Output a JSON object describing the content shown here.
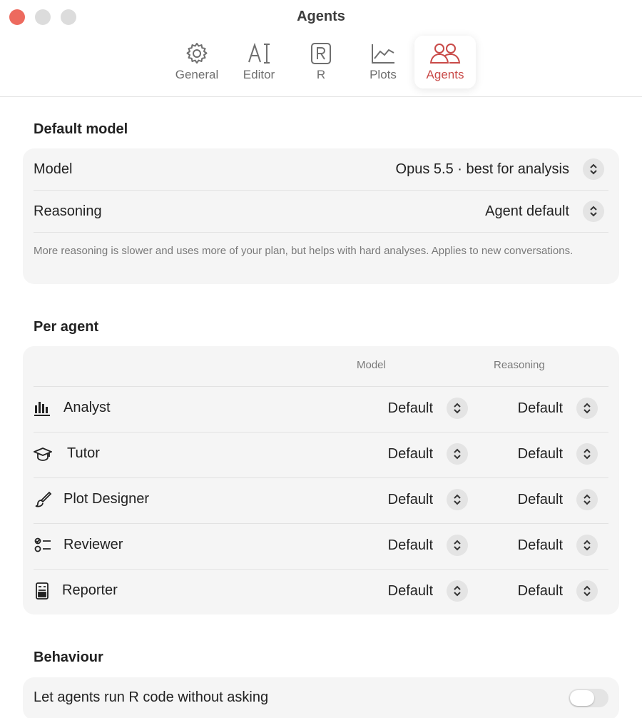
{
  "window": {
    "title": "Agents"
  },
  "tabs": [
    {
      "label": "General",
      "icon": "gear-icon"
    },
    {
      "label": "Editor",
      "icon": "text-cursor-icon"
    },
    {
      "label": "R",
      "icon": "r-box-icon"
    },
    {
      "label": "Plots",
      "icon": "line-chart-icon"
    },
    {
      "label": "Agents",
      "icon": "people-icon",
      "active": true
    }
  ],
  "default_model": {
    "title": "Default model",
    "model_label": "Model",
    "model_value": "Opus 5.5 · best for analysis",
    "reasoning_label": "Reasoning",
    "reasoning_value": "Agent default",
    "help": "More reasoning is slower and uses more of your plan, but helps with hard analyses. Applies to new conversations."
  },
  "per_agent": {
    "title": "Per agent",
    "col_model": "Model",
    "col_reasoning": "Reasoning",
    "agents": [
      {
        "name": "Analyst",
        "icon": "bar-chart-icon",
        "model": "Default",
        "reasoning": "Default"
      },
      {
        "name": "Tutor",
        "icon": "graduation-cap-icon",
        "model": "Default",
        "reasoning": "Default"
      },
      {
        "name": "Plot Designer",
        "icon": "paintbrush-icon",
        "model": "Default",
        "reasoning": "Default"
      },
      {
        "name": "Reviewer",
        "icon": "checklist-icon",
        "model": "Default",
        "reasoning": "Default"
      },
      {
        "name": "Reporter",
        "icon": "report-icon",
        "model": "Default",
        "reasoning": "Default"
      }
    ]
  },
  "behaviour": {
    "title": "Behaviour",
    "run_r_label": "Let agents run R code without asking",
    "run_r_enabled": false
  },
  "colors": {
    "accent": "#c94a48",
    "close": "#ed6a5e",
    "card": "#f5f5f5"
  }
}
